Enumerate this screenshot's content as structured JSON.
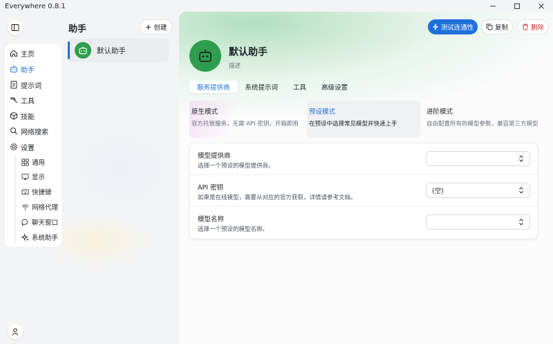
{
  "window": {
    "title": "Everywhere 0.8.1",
    "controls": [
      "minimize-icon",
      "maximize-icon",
      "close-icon"
    ]
  },
  "nav": {
    "items": [
      {
        "label": "主页",
        "icon": "home-icon"
      },
      {
        "label": "助手",
        "icon": "robot-icon",
        "active": true
      },
      {
        "label": "提示词",
        "icon": "document-icon"
      },
      {
        "label": "工具",
        "icon": "hammer-icon"
      },
      {
        "label": "技能",
        "icon": "cube-icon"
      },
      {
        "label": "网络搜索",
        "icon": "search-icon"
      },
      {
        "label": "设置",
        "icon": "gear-icon"
      }
    ],
    "settings_items": [
      {
        "label": "通用",
        "icon": "apps-icon"
      },
      {
        "label": "显示",
        "icon": "monitor-icon"
      },
      {
        "label": "快捷键",
        "icon": "keyboard-icon"
      },
      {
        "label": "网络代理",
        "icon": "wifi-icon"
      },
      {
        "label": "聊天窗口",
        "icon": "chat-icon"
      },
      {
        "label": "系统助手",
        "icon": "sparkle-icon"
      }
    ]
  },
  "list": {
    "title": "助手",
    "create_label": "创建",
    "items": [
      {
        "name": "默认助手",
        "selected": true
      }
    ]
  },
  "main": {
    "actions": {
      "test_label": "测试连通性",
      "copy_label": "复制",
      "delete_label": "删除"
    },
    "assistant": {
      "title": "默认助手",
      "description": "描述"
    },
    "tabs": [
      {
        "label": "服务提供商",
        "active": true
      },
      {
        "label": "系统提示词"
      },
      {
        "label": "工具"
      },
      {
        "label": "高级设置"
      }
    ],
    "modes": [
      {
        "title": "原生模式",
        "desc": "官方托管服务，无需 API 密钥，开箱即用"
      },
      {
        "title": "预设模式",
        "desc": "在预设中选择常见模型并快速上手",
        "active": true
      },
      {
        "title": "进阶模式",
        "desc": "自由配置所有的模型参数，兼容第三方模型"
      }
    ],
    "fields": [
      {
        "label": "模型提供商",
        "hint": "选择一个预设的模型提供商。",
        "value": ""
      },
      {
        "label": "API 密钥",
        "hint": "如果是在线模型，需要从对应的官方获取，详情请参考文档。",
        "value": "(空)"
      },
      {
        "label": "模型名称",
        "hint": "选择一个预设的模型名称。",
        "value": ""
      }
    ]
  },
  "colors": {
    "accent": "#1e6fd9",
    "avatar": "#2e9e4e",
    "danger": "#dd3333"
  }
}
